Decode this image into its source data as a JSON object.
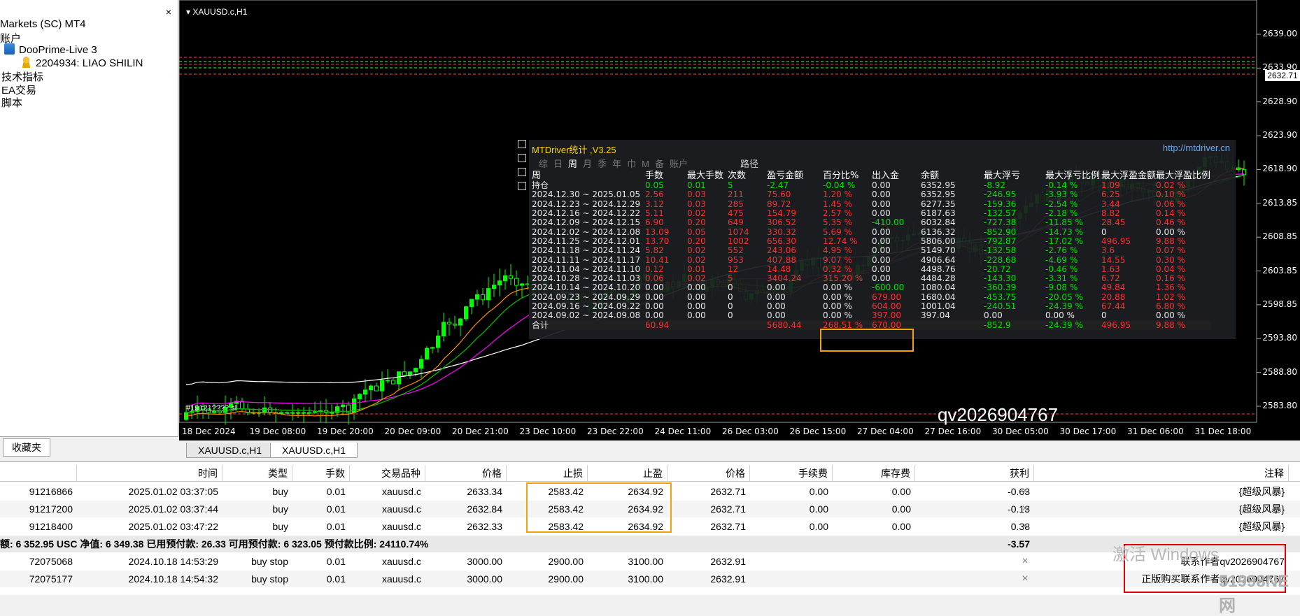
{
  "navigator": {
    "close": "×",
    "items": [
      {
        "label": "Markets (SC) MT4"
      },
      {
        "label": "账户"
      },
      {
        "label": "DooPrime-Live 3"
      },
      {
        "label": "2204934: LIAO SHILIN"
      },
      {
        "label": "技术指标"
      },
      {
        "label": "EA交易"
      },
      {
        "label": "脚本"
      }
    ],
    "favorites_tab": "收藏夹"
  },
  "chart": {
    "title": "XAUUSD.c,H1",
    "price_labels": [
      "2639.00",
      "2633.90",
      "2628.90",
      "2623.90",
      "2618.90",
      "2613.85",
      "2608.85",
      "2603.85",
      "2598.85",
      "2593.80",
      "2588.80",
      "2583.80"
    ],
    "current_price": "2632.71",
    "time_labels": [
      "18 Dec 2024",
      "19 Dec 08:00",
      "19 Dec 20:00",
      "20 Dec 09:00",
      "20 Dec 21:00",
      "23 Dec 10:00",
      "23 Dec 22:00",
      "24 Dec 11:00",
      "26 Dec 03:00",
      "26 Dec 15:00",
      "27 Dec 04:00",
      "27 Dec 16:00",
      "30 Dec 05:00",
      "30 Dec 17:00",
      "31 Dec 06:00",
      "31 Dec 18:00"
    ],
    "order_label": "#19121???? sl",
    "colors": {
      "bull": "#00ff00",
      "bear": "#00ff00",
      "ma_slow": "#ffffff",
      "ma_mid": "#ff00ff",
      "ma_fast": "#00c000",
      "ma_orange": "#ff8c00"
    }
  },
  "mtd": {
    "title": "MTDriver统计 ,V3.25",
    "url": "http://mtdriver.cn",
    "tabs": [
      "综",
      "日",
      "周",
      "月",
      "季",
      "年",
      "巾",
      "M",
      "备",
      "账户"
    ],
    "active_tab": "周",
    "path_label": "路径",
    "watermark": "qv2026904767",
    "headers": [
      "周",
      "手数",
      "最大手数",
      "次数",
      "盈亏金额",
      "百分比%",
      "出入金",
      "余额",
      "最大浮亏",
      "最大浮亏比例",
      "最大浮盈金额",
      "最大浮盈比例"
    ],
    "rows": [
      {
        "c": [
          "持仓",
          "0.05",
          "0.01",
          "5",
          "-2.47",
          "-0.04 %",
          "0.00",
          "6352.95",
          "-8.92",
          "-0.14 %",
          "1.09",
          "0.02 %"
        ],
        "k": [
          "w",
          "g",
          "g",
          "g",
          "g",
          "g",
          "w",
          "w",
          "g",
          "g",
          "r",
          "r"
        ]
      },
      {
        "c": [
          "2024.12.30 ~ 2025.01.05",
          "2.56",
          "0.03",
          "211",
          "75.60",
          "1.20 %",
          "0.00",
          "6352.95",
          "-246.95",
          "-3.93 %",
          "6.25",
          "0.10 %"
        ],
        "k": [
          "w",
          "r",
          "r",
          "r",
          "r",
          "r",
          "w",
          "w",
          "g",
          "g",
          "r",
          "r"
        ]
      },
      {
        "c": [
          "2024.12.23 ~ 2024.12.29",
          "3.12",
          "0.03",
          "285",
          "89.72",
          "1.45 %",
          "0.00",
          "6277.35",
          "-159.36",
          "-2.54 %",
          "3.44",
          "0.06 %"
        ],
        "k": [
          "w",
          "r",
          "r",
          "r",
          "r",
          "r",
          "w",
          "w",
          "g",
          "g",
          "r",
          "r"
        ]
      },
      {
        "c": [
          "2024.12.16 ~ 2024.12.22",
          "5.11",
          "0.02",
          "475",
          "154.79",
          "2.57 %",
          "0.00",
          "6187.63",
          "-132.57",
          "-2.18 %",
          "8.82",
          "0.14 %"
        ],
        "k": [
          "w",
          "r",
          "r",
          "r",
          "r",
          "r",
          "w",
          "w",
          "g",
          "g",
          "r",
          "r"
        ]
      },
      {
        "c": [
          "2024.12.09 ~ 2024.12.15",
          "6.90",
          "0.20",
          "649",
          "306.52",
          "5.35 %",
          "-410.00",
          "6032.84",
          "-727.38",
          "-11.85 %",
          "28.45",
          "0.46 %"
        ],
        "k": [
          "w",
          "r",
          "r",
          "r",
          "r",
          "r",
          "g",
          "w",
          "g",
          "g",
          "r",
          "r"
        ]
      },
      {
        "c": [
          "2024.12.02 ~ 2024.12.08",
          "13.09",
          "0.05",
          "1074",
          "330.32",
          "5.69 %",
          "0.00",
          "6136.32",
          "-852.90",
          "-14.73 %",
          "0",
          "0.00 %"
        ],
        "k": [
          "w",
          "r",
          "r",
          "r",
          "r",
          "r",
          "w",
          "w",
          "g",
          "g",
          "w",
          "w"
        ]
      },
      {
        "c": [
          "2024.11.25 ~ 2024.12.01",
          "13.70",
          "0.20",
          "1002",
          "656.30",
          "12.74 %",
          "0.00",
          "5806.00",
          "-792.87",
          "-17.02 %",
          "496.95",
          "9.88 %"
        ],
        "k": [
          "w",
          "r",
          "r",
          "r",
          "r",
          "r",
          "w",
          "w",
          "g",
          "g",
          "r",
          "r"
        ]
      },
      {
        "c": [
          "2024.11.18 ~ 2024.11.24",
          "5.82",
          "0.02",
          "552",
          "243.06",
          "4.95 %",
          "0.00",
          "5149.70",
          "-132.58",
          "-2.76 %",
          "3.6",
          "0.07 %"
        ],
        "k": [
          "w",
          "r",
          "r",
          "r",
          "r",
          "r",
          "w",
          "w",
          "g",
          "g",
          "r",
          "r"
        ]
      },
      {
        "c": [
          "2024.11.11 ~ 2024.11.17",
          "10.41",
          "0.02",
          "953",
          "407.88",
          "9.07 %",
          "0.00",
          "4906.64",
          "-228.68",
          "-4.69 %",
          "14.55",
          "0.30 %"
        ],
        "k": [
          "w",
          "r",
          "r",
          "r",
          "r",
          "r",
          "w",
          "w",
          "g",
          "g",
          "r",
          "r"
        ]
      },
      {
        "c": [
          "2024.11.04 ~ 2024.11.10",
          "0.12",
          "0.01",
          "12",
          "14.48",
          "0.32 %",
          "0.00",
          "4498.76",
          "-20.72",
          "-0.46 %",
          "1.63",
          "0.04 %"
        ],
        "k": [
          "w",
          "r",
          "r",
          "r",
          "r",
          "r",
          "w",
          "w",
          "g",
          "g",
          "r",
          "r"
        ]
      },
      {
        "c": [
          "2024.10.28 ~ 2024.11.03",
          "0.06",
          "0.02",
          "5",
          "3404.24",
          "315.20 %",
          "0.00",
          "4484.28",
          "-143.30",
          "-3.31 %",
          "6.72",
          "0.16 %"
        ],
        "k": [
          "w",
          "r",
          "r",
          "r",
          "r",
          "r",
          "w",
          "w",
          "g",
          "g",
          "r",
          "r"
        ]
      },
      {
        "c": [
          "2024.10.14 ~ 2024.10.20",
          "0.00",
          "0.00",
          "0",
          "0.00",
          "0.00 %",
          "-600.00",
          "1080.04",
          "-360.39",
          "-9.08 %",
          "49.84",
          "1.36 %"
        ],
        "k": [
          "w",
          "w",
          "w",
          "w",
          "w",
          "w",
          "g",
          "w",
          "g",
          "g",
          "r",
          "r"
        ]
      },
      {
        "c": [
          "2024.09.23 ~ 2024.09.29",
          "0.00",
          "0.00",
          "0",
          "0.00",
          "0.00 %",
          "679.00",
          "1680.04",
          "-453.75",
          "-20.05 %",
          "20.88",
          "1.02 %"
        ],
        "k": [
          "w",
          "w",
          "w",
          "w",
          "w",
          "w",
          "r",
          "w",
          "g",
          "g",
          "r",
          "r"
        ]
      },
      {
        "c": [
          "2024.09.16 ~ 2024.09.22",
          "0.00",
          "0.00",
          "0",
          "0.00",
          "0.00 %",
          "604.00",
          "1001.04",
          "-240.51",
          "-24.39 %",
          "67.44",
          "6.80 %"
        ],
        "k": [
          "w",
          "w",
          "w",
          "w",
          "w",
          "w",
          "r",
          "w",
          "g",
          "g",
          "r",
          "r"
        ]
      },
      {
        "c": [
          "2024.09.02 ~ 2024.09.08",
          "0.00",
          "0.00",
          "0",
          "0.00",
          "0.00 %",
          "397.00",
          "397.04",
          "0.00",
          "0.00 %",
          "0",
          "0.00 %"
        ],
        "k": [
          "w",
          "w",
          "w",
          "w",
          "w",
          "w",
          "r",
          "w",
          "w",
          "w",
          "w",
          "w"
        ]
      },
      {
        "c": [
          "合计",
          "60.94",
          "",
          "",
          "5680.44",
          "268.51 %",
          "670.00",
          "",
          "-852.9",
          "-24.39 %",
          "496.95",
          "9.88 %"
        ],
        "k": [
          "w",
          "r",
          "w",
          "w",
          "r",
          "r",
          "r",
          "w",
          "g",
          "g",
          "r",
          "r"
        ]
      }
    ]
  },
  "chart_tabs": [
    "XAUUSD.c,H1",
    "XAUUSD.c,H1"
  ],
  "terminal": {
    "headers": [
      "",
      "时间",
      "类型",
      "手数",
      "交易品种",
      "价格",
      "止损",
      "止盈",
      "价格",
      "手续费",
      "库存费",
      "获利",
      "注释"
    ],
    "rows": [
      [
        "91216866",
        "2025.01.02 03:37:05",
        "buy",
        "0.01",
        "xauusd.c",
        "2633.34",
        "2583.42",
        "2634.92",
        "2632.71",
        "0.00",
        "0.00",
        "-0.63",
        "{超级风暴}"
      ],
      [
        "91217200",
        "2025.01.02 03:37:44",
        "buy",
        "0.01",
        "xauusd.c",
        "2632.84",
        "2583.42",
        "2634.92",
        "2632.71",
        "0.00",
        "0.00",
        "-0.13",
        "{超级风暴}"
      ],
      [
        "91218400",
        "2025.01.02 03:47:22",
        "buy",
        "0.01",
        "xauusd.c",
        "2632.33",
        "2583.42",
        "2634.92",
        "2632.71",
        "0.00",
        "0.00",
        "0.38",
        "{超级风暴}"
      ]
    ],
    "summary": {
      "text": "额: 6 352.95 USC  净值: 6 349.38  已用预付款: 26.33  可用预付款: 6 323.05  预付款比例: 24110.74%",
      "profit": "-3.57"
    },
    "pending": [
      [
        "72075068",
        "2024.10.18 14:53:29",
        "buy stop",
        "0.01",
        "xauusd.c",
        "3000.00",
        "2900.00",
        "3100.00",
        "2632.91",
        "",
        "",
        "",
        "联系作者qv2026904767"
      ],
      [
        "72075177",
        "2024.10.18 14:54:32",
        "buy stop",
        "0.01",
        "xauusd.c",
        "3000.00",
        "2900.00",
        "3100.00",
        "2632.91",
        "",
        "",
        "",
        "正版购买联系作者qv2026904767"
      ]
    ],
    "close_icon": "×"
  },
  "overlay_text": {
    "win_activate": "激活 Windows",
    "win_activate2": "转到\"设置\"以激活 Windows。",
    "site": "51998NE网"
  }
}
